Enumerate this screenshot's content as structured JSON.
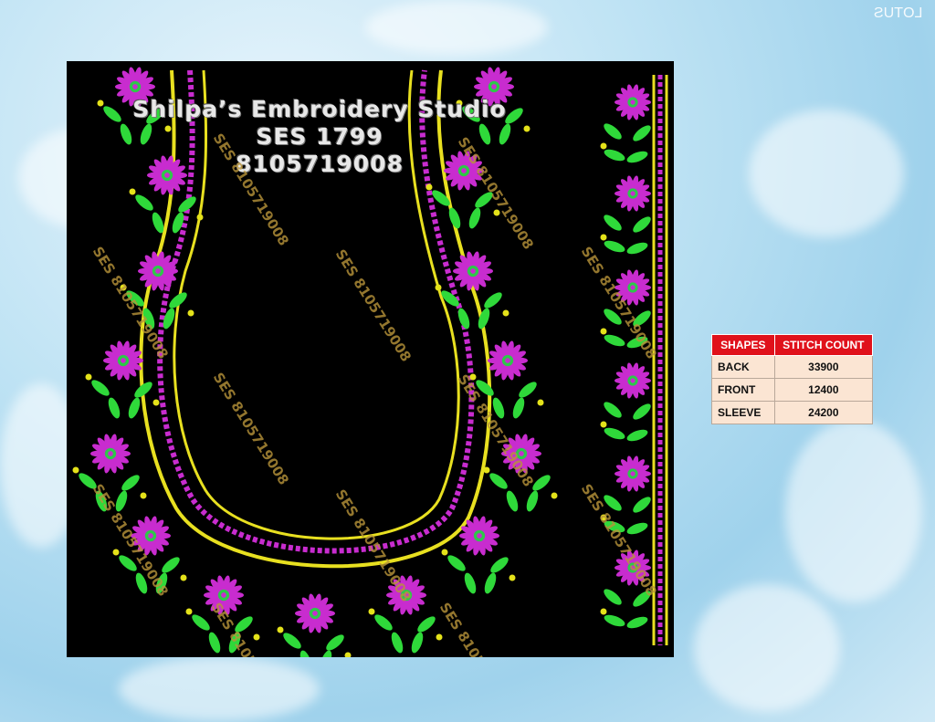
{
  "design": {
    "studio_name": "Shilpa’s Embroidery Studio",
    "design_code": "SES 1799",
    "phone": "8105719008",
    "watermark_text": "SES 8105719008",
    "colors": {
      "background": "#000000",
      "flower": "#c82ccf",
      "flower_center": "#2ec84a",
      "leaf": "#2fd93a",
      "border_yellow": "#e8e020",
      "dot_yellow": "#e4e21a"
    }
  },
  "corner_mark": "LOTUS",
  "stitch_table": {
    "headers": [
      "SHAPES",
      "STITCH COUNT"
    ],
    "rows": [
      {
        "shape": "BACK",
        "count": "33900"
      },
      {
        "shape": "FRONT",
        "count": "12400"
      },
      {
        "shape": "SLEEVE",
        "count": "24200"
      }
    ],
    "header_color": "#e0111b",
    "row_color": "#fbe5d3"
  }
}
